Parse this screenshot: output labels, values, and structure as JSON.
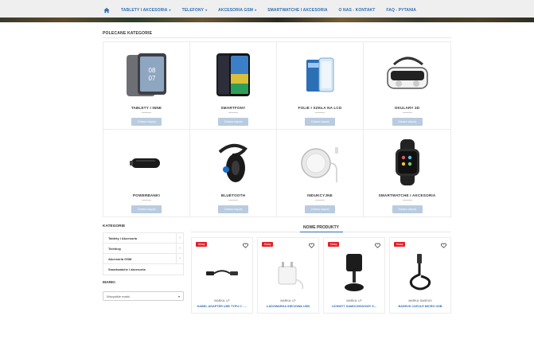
{
  "nav": {
    "home_icon": "home-icon",
    "items": [
      {
        "label": "TABLETY I AKCESORIA",
        "caret": "▾"
      },
      {
        "label": "TELEFONY",
        "caret": "▾"
      },
      {
        "label": "AKCESORIA GSM",
        "caret": "▾"
      },
      {
        "label": "SMARTWATCHE I AKCESORIA",
        "caret": ""
      },
      {
        "label": "O NAS - KONTAKT",
        "caret": ""
      },
      {
        "label": "FAQ - PYTANIA",
        "caret": ""
      }
    ],
    "accent": "#2f6fb3"
  },
  "featured": {
    "title": "POLECANE KATEGORIE",
    "button_label": "Zobacz więcej",
    "categories": [
      {
        "name": "TABLETY I INNE",
        "icon": "tablet-icon"
      },
      {
        "name": "SMARTFONY",
        "icon": "smartphone-icon"
      },
      {
        "name": "FOLIE I SZKŁA NA LCD",
        "icon": "screen-protector-icon"
      },
      {
        "name": "OKULARY 3D",
        "icon": "vr-headset-icon"
      },
      {
        "name": "POWERBANKI",
        "icon": "powerbank-icon"
      },
      {
        "name": "BLUETOOTH",
        "icon": "bluetooth-headset-icon"
      },
      {
        "name": "INDUKCYJNE",
        "icon": "wireless-charger-icon"
      },
      {
        "name": "SMARTWATCHE I AKCESORIA",
        "icon": "smartwatch-icon"
      }
    ]
  },
  "sidebar": {
    "categories_title": "KATEGORIE",
    "items": [
      {
        "label": "Tablety i Akcesoria",
        "expand": "›"
      },
      {
        "label": "Telefony",
        "expand": "›"
      },
      {
        "label": "Akcesoria GSM",
        "expand": "›"
      },
      {
        "label": "Smartwatche i akcesoria",
        "expand": ""
      }
    ],
    "brands_title": "MARKI",
    "brands_select": "Wszystkie marki",
    "brands_caret": "▾"
  },
  "new_products": {
    "title": "NOWE PRODUKTY",
    "badge_color": "#e41e26",
    "items": [
      {
        "badge": "Nowy",
        "brand": "MARKA: LP",
        "name": "KABEL ADAPTER USB TYPU C - ...",
        "icon": "usb-adapter-cable-icon"
      },
      {
        "badge": "Nowy",
        "brand": "MARKA: LP",
        "name": "ŁADOWARKA SIECIOWA USB",
        "icon": "wall-charger-icon"
      },
      {
        "badge": "Nowy",
        "brand": "MARKA: LP",
        "name": "UCHWYT SAMOCHODOWY S...",
        "icon": "car-holder-icon"
      },
      {
        "badge": "Nowy",
        "brand": "MARKA: BASEUS",
        "name": "BASEUS CAFULE MICRO USB",
        "icon": "braided-cable-icon"
      }
    ]
  }
}
